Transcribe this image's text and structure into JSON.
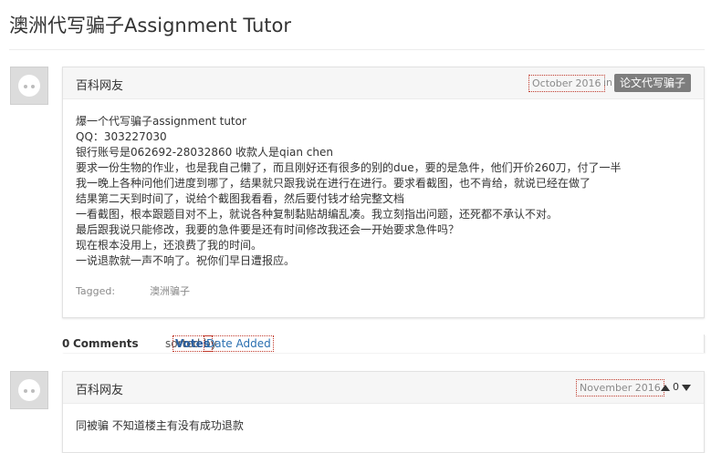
{
  "page": {
    "title": "澳洲代写骗子Assignment Tutor"
  },
  "post": {
    "author": "百科网友",
    "date": "October 2016",
    "in_label": "in",
    "category": "论文代写骗子",
    "lines": [
      "爆一个代写骗子assignment tutor",
      "QQ：303227030",
      "银行账号是062692-28032860 收款人是qian chen",
      "要求一份生物的作业，也是我自己懒了，而且刚好还有很多的别的due，要的是急件，他们开价260刀，付了一半",
      "我一晚上各种问他们进度到哪了，结果就只跟我说在进行在进行。要求看截图，也不肯给，就说已经在做了",
      "结果第二天到时间了，说给个截图我看看，然后要付钱才给完整文档",
      "一看截图，根本跟题目对不上，就说各种复制黏贴胡编乱凑。我立刻指出问题，还死都不承认不对。",
      "最后跟我说只能修改，我要的急件要是还有时间修改我还会一开始要求急件吗？",
      "现在根本没用上，还浪费了我的时间。",
      "一说退款就一声不响了。祝你们早日遭报应。"
    ],
    "tagged_label": "Tagged:",
    "tag": "澳洲骗子"
  },
  "comments_bar": {
    "count": "0",
    "count_label": "Comments",
    "sorted_by": "sorted by",
    "sort_options": [
      "Votes",
      "Date Added"
    ]
  },
  "comment": {
    "author": "百科网友",
    "date": "November 2016",
    "votes": "0",
    "text": "同被骗 不知道楼主有没有成功退款"
  }
}
